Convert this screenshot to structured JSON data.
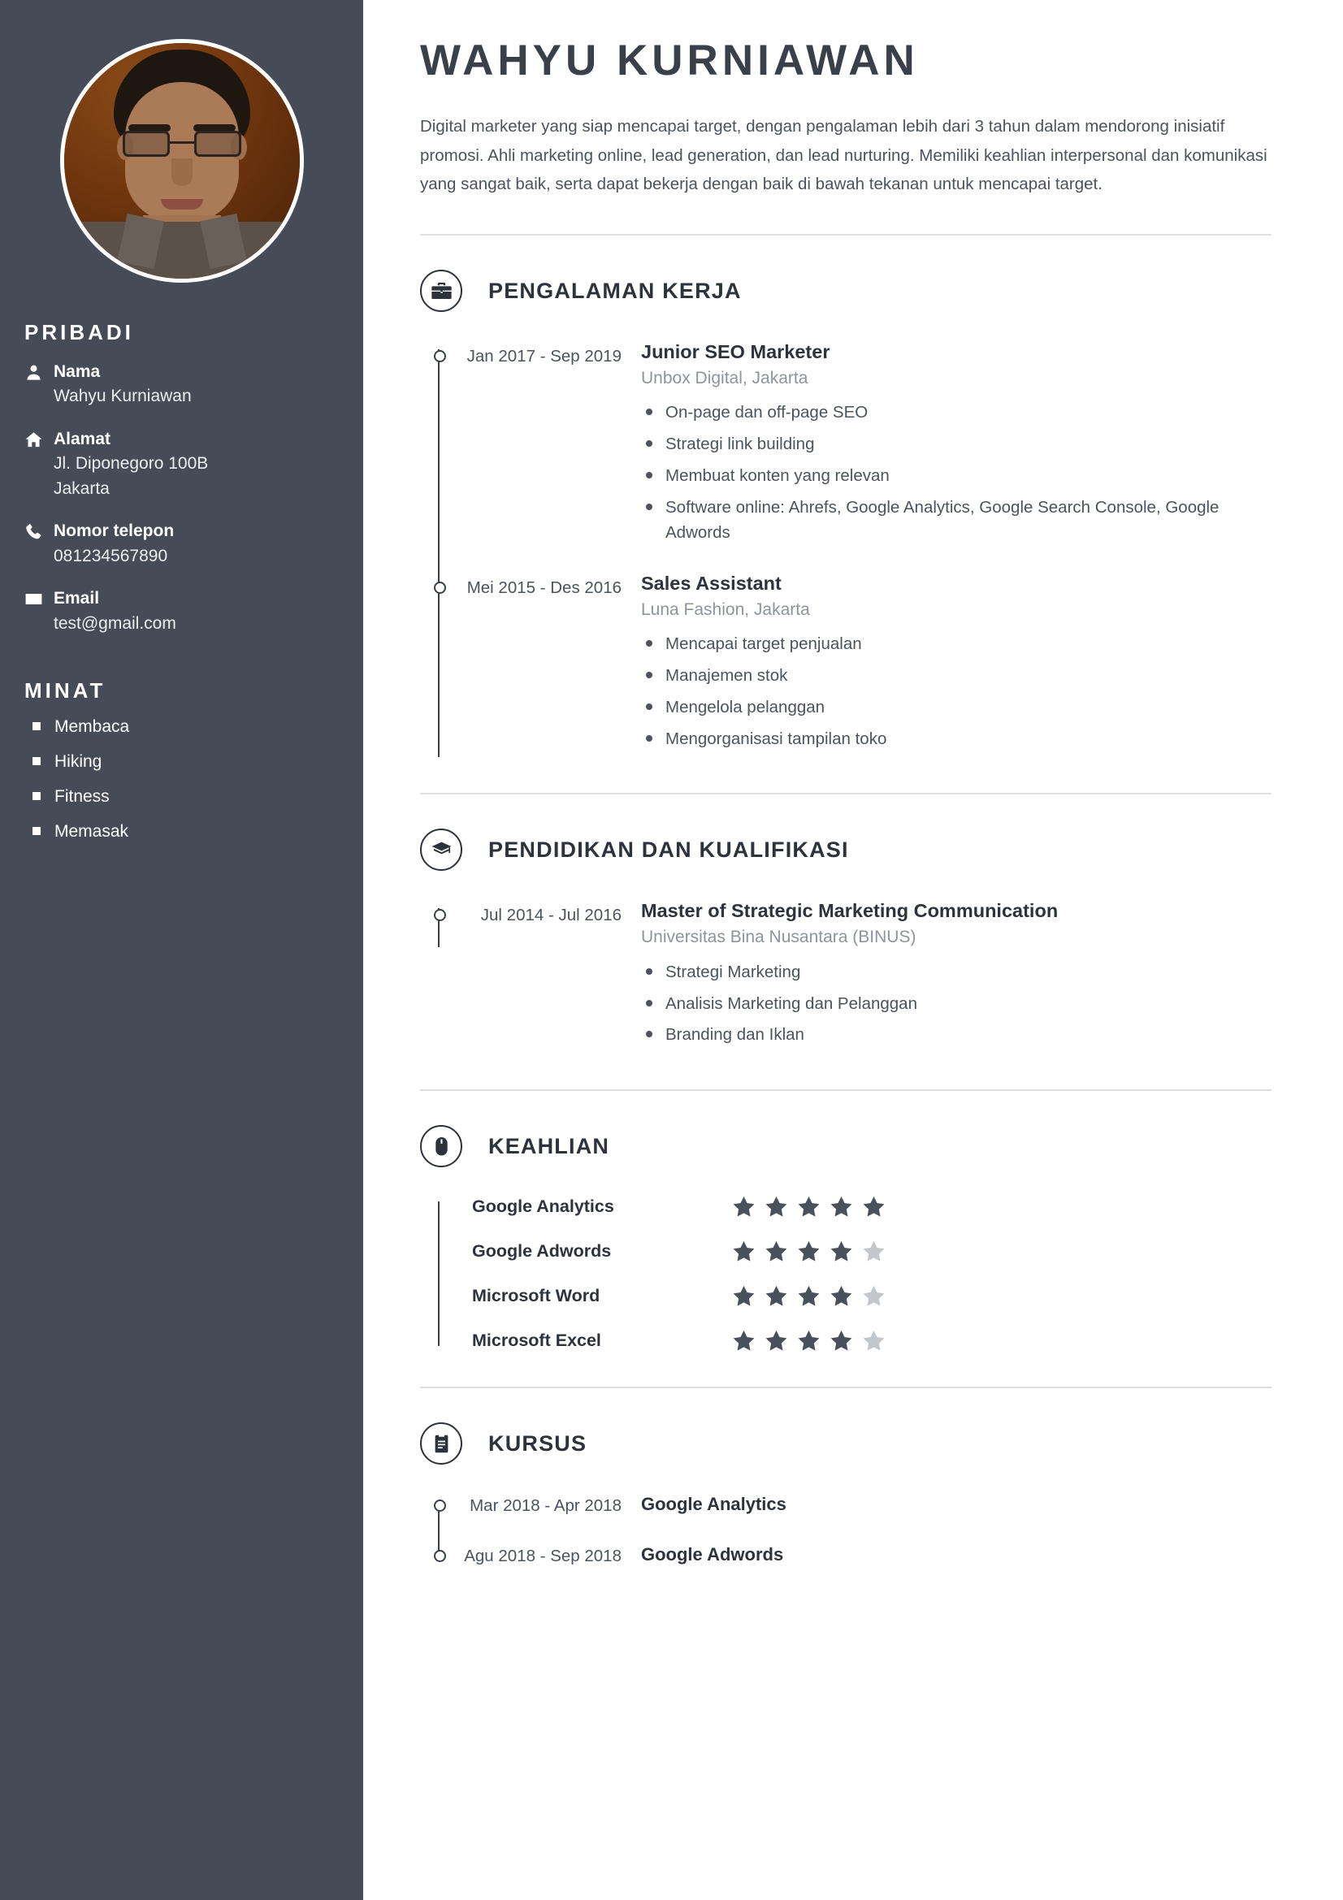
{
  "sidebar": {
    "avatar_alt": "profile-photo",
    "personal_heading": "PRIBADI",
    "contacts": [
      {
        "icon": "person-icon",
        "label": "Nama",
        "value": "Wahyu Kurniawan"
      },
      {
        "icon": "home-icon",
        "label": "Alamat",
        "value": "Jl. Diponegoro 100B\nJakarta"
      },
      {
        "icon": "phone-icon",
        "label": "Nomor telepon",
        "value": "081234567890"
      },
      {
        "icon": "envelope-icon",
        "label": "Email",
        "value": "test@gmail.com"
      }
    ],
    "interests_heading": "MINAT",
    "interests": [
      "Membaca",
      "Hiking",
      "Fitness",
      "Memasak"
    ]
  },
  "main": {
    "name": "WAHYU KURNIAWAN",
    "summary": "Digital marketer yang siap mencapai target, dengan pengalaman lebih dari 3 tahun dalam mendorong inisiatif promosi. Ahli marketing online, lead generation, dan lead nurturing. Memiliki keahlian interpersonal dan komunikasi yang sangat baik, serta dapat bekerja dengan baik di bawah tekanan untuk mencapai target.",
    "experience": {
      "icon": "briefcase-icon",
      "title": "PENGALAMAN KERJA",
      "entries": [
        {
          "date": "Jan 2017 - Sep 2019",
          "role": "Junior SEO Marketer",
          "org": "Unbox Digital, Jakarta",
          "bullets": [
            "On-page dan off-page SEO",
            "Strategi link building",
            "Membuat konten yang relevan",
            "Software online: Ahrefs, Google Analytics, Google Search Console, Google Adwords"
          ]
        },
        {
          "date": "Mei 2015 - Des 2016",
          "role": "Sales Assistant",
          "org": "Luna Fashion, Jakarta",
          "bullets": [
            "Mencapai target penjualan",
            "Manajemen stok",
            "Mengelola pelanggan",
            "Mengorganisasi tampilan toko"
          ]
        }
      ]
    },
    "education": {
      "icon": "graduation-cap-icon",
      "title": "PENDIDIKAN DAN KUALIFIKASI",
      "entries": [
        {
          "date": "Jul 2014 - Jul 2016",
          "role": "Master of Strategic Marketing Communication",
          "org": "Universitas Bina Nusantara (BINUS)",
          "bullets": [
            "Strategi Marketing",
            "Analisis Marketing dan Pelanggan",
            "Branding dan Iklan"
          ]
        }
      ]
    },
    "skills": {
      "icon": "mouse-icon",
      "title": "KEAHLIAN",
      "max_stars": 5,
      "items": [
        {
          "name": "Google Analytics",
          "rating": 5
        },
        {
          "name": "Google Adwords",
          "rating": 4
        },
        {
          "name": "Microsoft Word",
          "rating": 4
        },
        {
          "name": "Microsoft Excel",
          "rating": 4
        }
      ]
    },
    "courses": {
      "icon": "certificate-icon",
      "title": "KURSUS",
      "entries": [
        {
          "date": "Mar 2018 - Apr 2018",
          "name": "Google Analytics"
        },
        {
          "date": "Agu 2018 - Sep 2018",
          "name": "Google Adwords"
        }
      ]
    }
  },
  "colors": {
    "sidebar_bg": "#454c57",
    "ink": "#2e333b",
    "muted": "#8d949c",
    "star_on": "#4a515a",
    "star_off": "#c3c6ca"
  }
}
